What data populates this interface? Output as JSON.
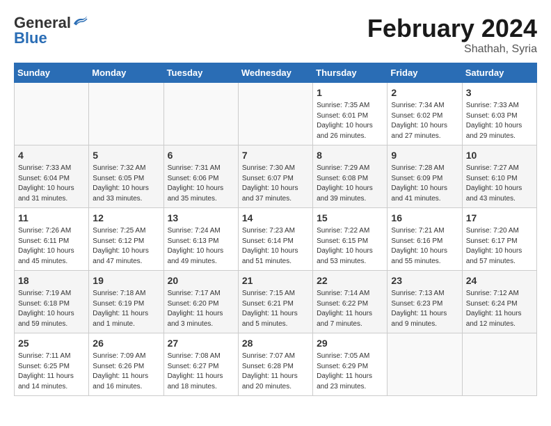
{
  "header": {
    "logo_general": "General",
    "logo_blue": "Blue",
    "month": "February 2024",
    "location": "Shathah, Syria"
  },
  "days_of_week": [
    "Sunday",
    "Monday",
    "Tuesday",
    "Wednesday",
    "Thursday",
    "Friday",
    "Saturday"
  ],
  "weeks": [
    [
      {
        "day": "",
        "info": ""
      },
      {
        "day": "",
        "info": ""
      },
      {
        "day": "",
        "info": ""
      },
      {
        "day": "",
        "info": ""
      },
      {
        "day": "1",
        "info": "Sunrise: 7:35 AM\nSunset: 6:01 PM\nDaylight: 10 hours and 26 minutes."
      },
      {
        "day": "2",
        "info": "Sunrise: 7:34 AM\nSunset: 6:02 PM\nDaylight: 10 hours and 27 minutes."
      },
      {
        "day": "3",
        "info": "Sunrise: 7:33 AM\nSunset: 6:03 PM\nDaylight: 10 hours and 29 minutes."
      }
    ],
    [
      {
        "day": "4",
        "info": "Sunrise: 7:33 AM\nSunset: 6:04 PM\nDaylight: 10 hours and 31 minutes."
      },
      {
        "day": "5",
        "info": "Sunrise: 7:32 AM\nSunset: 6:05 PM\nDaylight: 10 hours and 33 minutes."
      },
      {
        "day": "6",
        "info": "Sunrise: 7:31 AM\nSunset: 6:06 PM\nDaylight: 10 hours and 35 minutes."
      },
      {
        "day": "7",
        "info": "Sunrise: 7:30 AM\nSunset: 6:07 PM\nDaylight: 10 hours and 37 minutes."
      },
      {
        "day": "8",
        "info": "Sunrise: 7:29 AM\nSunset: 6:08 PM\nDaylight: 10 hours and 39 minutes."
      },
      {
        "day": "9",
        "info": "Sunrise: 7:28 AM\nSunset: 6:09 PM\nDaylight: 10 hours and 41 minutes."
      },
      {
        "day": "10",
        "info": "Sunrise: 7:27 AM\nSunset: 6:10 PM\nDaylight: 10 hours and 43 minutes."
      }
    ],
    [
      {
        "day": "11",
        "info": "Sunrise: 7:26 AM\nSunset: 6:11 PM\nDaylight: 10 hours and 45 minutes."
      },
      {
        "day": "12",
        "info": "Sunrise: 7:25 AM\nSunset: 6:12 PM\nDaylight: 10 hours and 47 minutes."
      },
      {
        "day": "13",
        "info": "Sunrise: 7:24 AM\nSunset: 6:13 PM\nDaylight: 10 hours and 49 minutes."
      },
      {
        "day": "14",
        "info": "Sunrise: 7:23 AM\nSunset: 6:14 PM\nDaylight: 10 hours and 51 minutes."
      },
      {
        "day": "15",
        "info": "Sunrise: 7:22 AM\nSunset: 6:15 PM\nDaylight: 10 hours and 53 minutes."
      },
      {
        "day": "16",
        "info": "Sunrise: 7:21 AM\nSunset: 6:16 PM\nDaylight: 10 hours and 55 minutes."
      },
      {
        "day": "17",
        "info": "Sunrise: 7:20 AM\nSunset: 6:17 PM\nDaylight: 10 hours and 57 minutes."
      }
    ],
    [
      {
        "day": "18",
        "info": "Sunrise: 7:19 AM\nSunset: 6:18 PM\nDaylight: 10 hours and 59 minutes."
      },
      {
        "day": "19",
        "info": "Sunrise: 7:18 AM\nSunset: 6:19 PM\nDaylight: 11 hours and 1 minute."
      },
      {
        "day": "20",
        "info": "Sunrise: 7:17 AM\nSunset: 6:20 PM\nDaylight: 11 hours and 3 minutes."
      },
      {
        "day": "21",
        "info": "Sunrise: 7:15 AM\nSunset: 6:21 PM\nDaylight: 11 hours and 5 minutes."
      },
      {
        "day": "22",
        "info": "Sunrise: 7:14 AM\nSunset: 6:22 PM\nDaylight: 11 hours and 7 minutes."
      },
      {
        "day": "23",
        "info": "Sunrise: 7:13 AM\nSunset: 6:23 PM\nDaylight: 11 hours and 9 minutes."
      },
      {
        "day": "24",
        "info": "Sunrise: 7:12 AM\nSunset: 6:24 PM\nDaylight: 11 hours and 12 minutes."
      }
    ],
    [
      {
        "day": "25",
        "info": "Sunrise: 7:11 AM\nSunset: 6:25 PM\nDaylight: 11 hours and 14 minutes."
      },
      {
        "day": "26",
        "info": "Sunrise: 7:09 AM\nSunset: 6:26 PM\nDaylight: 11 hours and 16 minutes."
      },
      {
        "day": "27",
        "info": "Sunrise: 7:08 AM\nSunset: 6:27 PM\nDaylight: 11 hours and 18 minutes."
      },
      {
        "day": "28",
        "info": "Sunrise: 7:07 AM\nSunset: 6:28 PM\nDaylight: 11 hours and 20 minutes."
      },
      {
        "day": "29",
        "info": "Sunrise: 7:05 AM\nSunset: 6:29 PM\nDaylight: 11 hours and 23 minutes."
      },
      {
        "day": "",
        "info": ""
      },
      {
        "day": "",
        "info": ""
      }
    ]
  ]
}
